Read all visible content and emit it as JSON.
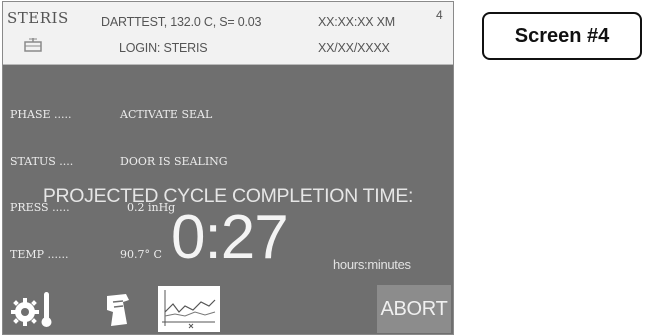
{
  "brand": {
    "logo_text": "STERIS"
  },
  "header": {
    "cycle_info": "DARTTEST, 132.0 C, S= 0.03",
    "login": "LOGIN: STERIS",
    "time": "XX:XX:XX XM",
    "date": "XX/XX/XXXX",
    "screen_number": "4"
  },
  "status": {
    "rows": [
      {
        "label": "PHASE .....",
        "value": "ACTIVATE SEAL"
      },
      {
        "label": "STATUS ....",
        "value": "DOOR IS SEALING"
      },
      {
        "label": "PRESS .....",
        "value": "  0.2 inHg"
      },
      {
        "label": "TEMP ......",
        "value": "90.7° C"
      }
    ]
  },
  "projection": {
    "label": "PROJECTED CYCLE COMPLETION TIME:",
    "time": "0:27",
    "unit": "hours:minutes"
  },
  "toolbar": {
    "abort_label": "ABORT",
    "icons": [
      "gear-thermometer-icon",
      "printer-icon",
      "cycle-graph-icon"
    ]
  },
  "caption": {
    "label": "Screen #4"
  },
  "colors": {
    "panel": "#6f6f6f",
    "header": "#f2f2f2",
    "abort_button": "#8c8c8c",
    "text_light": "#ececec"
  }
}
